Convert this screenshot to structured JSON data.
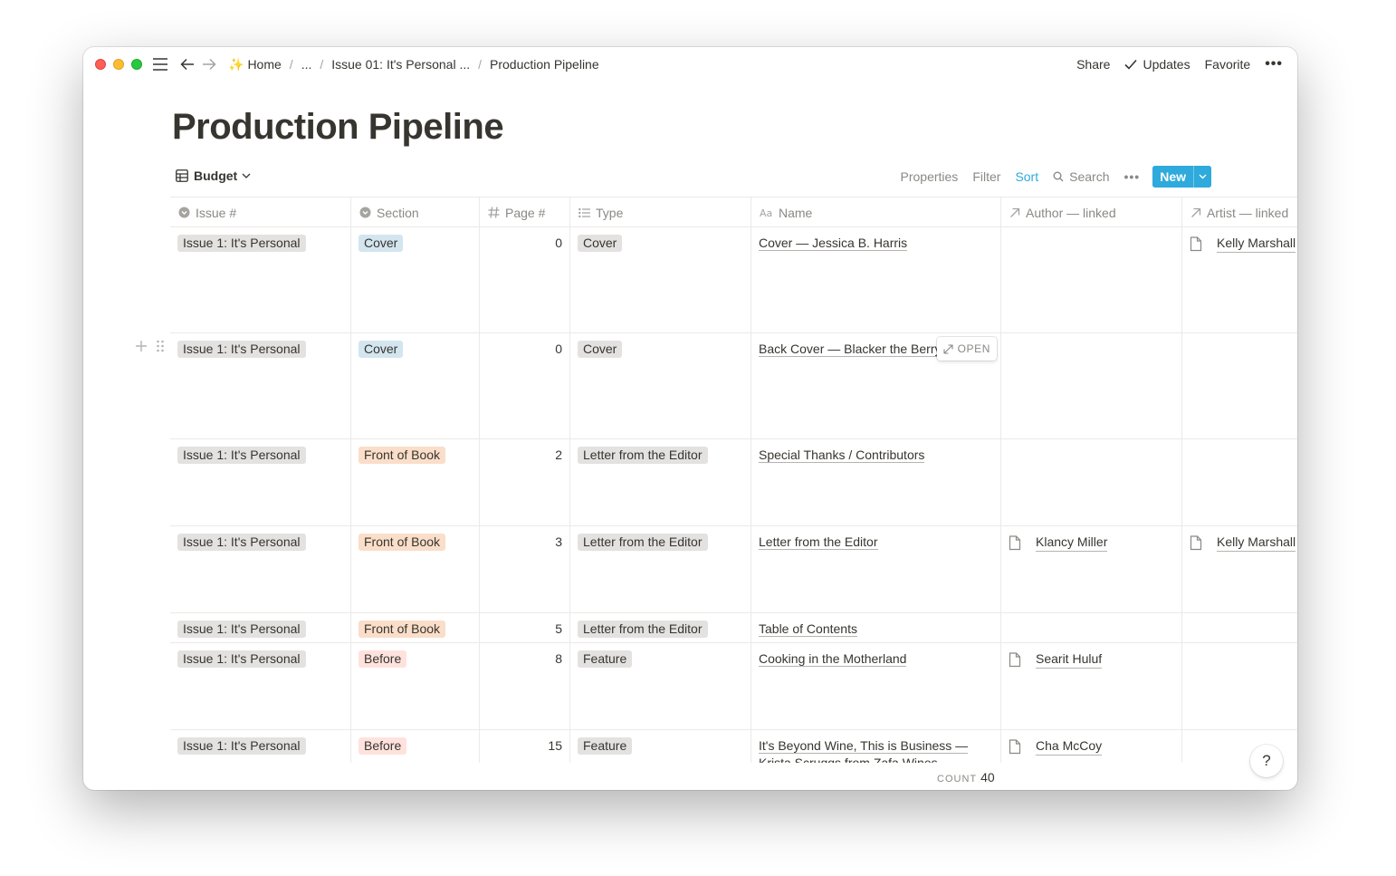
{
  "breadcrumb": {
    "home_emoji": "✨",
    "home": "Home",
    "ellipsis": "...",
    "issue": "Issue 01: It's Personal ...",
    "current": "Production Pipeline"
  },
  "topbar": {
    "share": "Share",
    "updates": "Updates",
    "favorite": "Favorite",
    "more": "•••"
  },
  "page": {
    "title": "Production Pipeline"
  },
  "view": {
    "name": "Budget",
    "properties": "Properties",
    "filter": "Filter",
    "sort": "Sort",
    "search": "Search",
    "more": "•••",
    "new": "New"
  },
  "columns": {
    "issue": "Issue #",
    "section": "Section",
    "page": "Page #",
    "type": "Type",
    "name": "Name",
    "author": "Author — linked",
    "artist": "Artist — linked"
  },
  "rows": [
    {
      "issue": "Issue 1: It's Personal",
      "section": "Cover",
      "section_color": "blue",
      "page": "0",
      "type": "Cover",
      "name": "Cover — Jessica B. Harris",
      "author": "",
      "artist": "Kelly Marshall"
    },
    {
      "issue": "Issue 1: It's Personal",
      "section": "Cover",
      "section_color": "blue",
      "page": "0",
      "type": "Cover",
      "name": "Back Cover — Blacker the Berry",
      "author": "",
      "artist": ""
    },
    {
      "issue": "Issue 1: It's Personal",
      "section": "Front of Book",
      "section_color": "orange",
      "page": "2",
      "type": "Letter from the Editor",
      "name": "Special Thanks / Contributors",
      "author": "",
      "artist": ""
    },
    {
      "issue": "Issue 1: It's Personal",
      "section": "Front of Book",
      "section_color": "orange",
      "page": "3",
      "type": "Letter from the Editor",
      "name": "Letter from the Editor",
      "author": "Klancy Miller",
      "artist": "Kelly Marshall"
    },
    {
      "issue": "Issue 1: It's Personal",
      "section": "Front of Book",
      "section_color": "orange",
      "page": "5",
      "type": "Letter from the Editor",
      "name": "Table of Contents",
      "author": "",
      "artist": ""
    },
    {
      "issue": "Issue 1: It's Personal",
      "section": "Before",
      "section_color": "red",
      "page": "8",
      "type": "Feature",
      "name": "Cooking in the Motherland",
      "author": "Searit Huluf",
      "artist": ""
    },
    {
      "issue": "Issue 1: It's Personal",
      "section": "Before",
      "section_color": "red",
      "page": "15",
      "type": "Feature",
      "name": "It's Beyond Wine, This is Business — Krista Scruggs from Zafa Wines",
      "author": "Cha McCoy",
      "artist": ""
    }
  ],
  "row_hover": {
    "open": "OPEN"
  },
  "footer": {
    "count_label": "COUNT",
    "count_value": "40"
  },
  "help": "?",
  "colors": {
    "accent": "#2eaadc",
    "tag_gray": "#e3e2e0",
    "tag_blue": "#d3e5ef",
    "tag_orange": "#fadec9",
    "tag_red": "#ffe2dd"
  }
}
